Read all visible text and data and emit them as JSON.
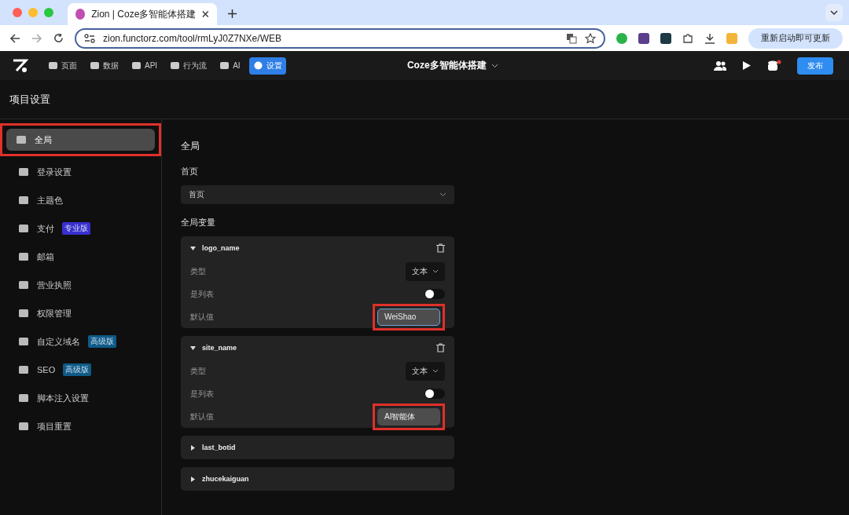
{
  "browser": {
    "tab_title": "Zion | Coze多智能体搭建",
    "url": "zion.functorz.com/tool/rmLyJ0Z7NXe/WEB",
    "update_button": "重新启动即可更新"
  },
  "app_header": {
    "nav": [
      {
        "label": "页面",
        "selected": false
      },
      {
        "label": "数据",
        "selected": false
      },
      {
        "label": "API",
        "selected": false
      },
      {
        "label": "行为流",
        "selected": false
      },
      {
        "label": "AI",
        "selected": false
      },
      {
        "label": "设置",
        "selected": true
      }
    ],
    "project_title": "Coze多智能体搭建",
    "publish_button": "发布"
  },
  "page_title": "项目设置",
  "sidebar": {
    "items": [
      {
        "label": "全局",
        "selected": true,
        "highlighted": true
      },
      {
        "label": "登录设置",
        "selected": false,
        "highlighted": false
      },
      {
        "label": "主题色",
        "selected": false,
        "highlighted": false
      },
      {
        "label": "支付",
        "selected": false,
        "highlighted": false,
        "badge": {
          "text": "专业版",
          "color": "#3a2fd0"
        }
      },
      {
        "label": "邮箱",
        "selected": false,
        "highlighted": false
      },
      {
        "label": "营业执照",
        "selected": false,
        "highlighted": false
      },
      {
        "label": "权限管理",
        "selected": false,
        "highlighted": false
      },
      {
        "label": "自定义域名",
        "selected": false,
        "highlighted": false,
        "badge": {
          "text": "高级版",
          "color": "#0f5a86"
        }
      },
      {
        "label": "SEO",
        "selected": false,
        "highlighted": false,
        "badge": {
          "text": "高级版",
          "color": "#0f5a86"
        }
      },
      {
        "label": "脚本注入设置",
        "selected": false,
        "highlighted": false
      },
      {
        "label": "项目重置",
        "selected": false,
        "highlighted": false
      }
    ]
  },
  "content": {
    "title": "全局",
    "home_label": "首页",
    "home_select": "首页",
    "variables_label": "全局变量",
    "variables": [
      {
        "name": "logo_name",
        "expanded": true,
        "type_label": "类型",
        "type_value": "文本",
        "list_label": "是列表",
        "is_list": false,
        "default_label": "默认值",
        "default_value": "WeiShao",
        "focused": true,
        "highlighted": true
      },
      {
        "name": "site_name",
        "expanded": true,
        "type_label": "类型",
        "type_value": "文本",
        "list_label": "是列表",
        "is_list": false,
        "default_label": "默认值",
        "default_value": "AI智能体",
        "focused": false,
        "highlighted": true
      },
      {
        "name": "last_botid",
        "expanded": false
      },
      {
        "name": "zhucekaiguan",
        "expanded": false
      }
    ]
  }
}
